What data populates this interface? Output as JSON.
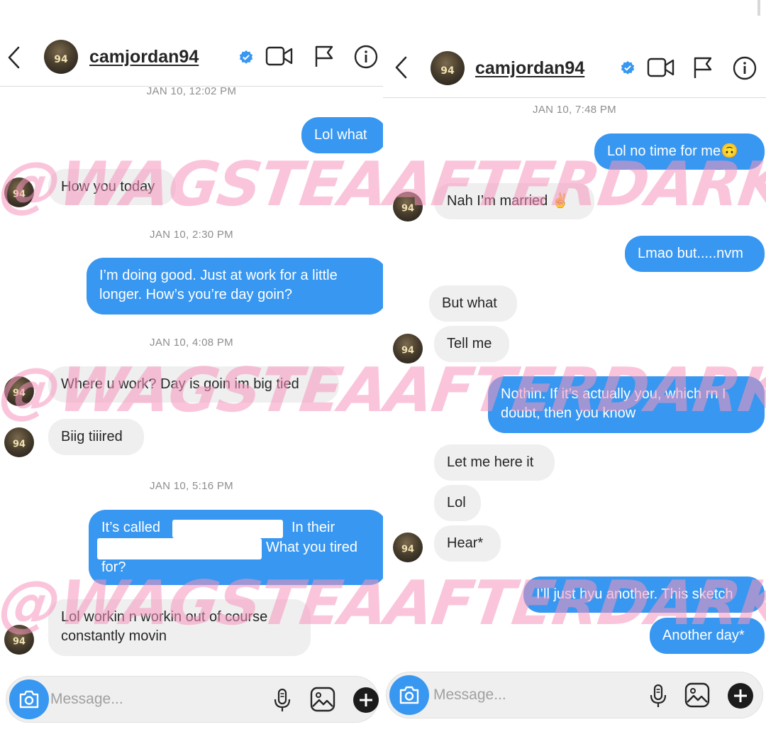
{
  "left": {
    "username": "camjordan94",
    "avatar_number": "94",
    "messages": {
      "ts1": "JAN 10, 12:02 PM",
      "m1": "Lol what",
      "m2": "How you today",
      "ts2": "JAN 10, 2:30 PM",
      "m3a": "I’m doing good. Just at work for a little",
      "m3b": "longer. How’s you’re day goin?",
      "ts3": "JAN 10, 4:08 PM",
      "m4": "Where u work? Day is goin im big tied",
      "m5": "Biig tiiired",
      "ts4": "JAN 10, 5:16 PM",
      "m6a": "It’s called",
      "m6b": "In their",
      "m6c": "What you tired",
      "m6d": "for?",
      "m7a": "Lol workin n workin out of course",
      "m7b": "constantly movin"
    },
    "composer_placeholder": "Message..."
  },
  "right": {
    "username": "camjordan94",
    "avatar_number": "94",
    "messages": {
      "ts1": "JAN 10, 7:48 PM",
      "m1": "Lol no time for me",
      "m1_emoji": "🙃",
      "m2": "Nah I’m married",
      "m2_emoji": "✌",
      "m3": "Lmao but.....nvm",
      "m4": "But what",
      "m5": "Tell me",
      "m6a": "Nothin. If it’s actually you, which rn I",
      "m6b": "doubt, then you know",
      "m7": "Let me here it",
      "m8": "Lol",
      "m9": "Hear*",
      "m10": "I’ll just hyu another. This sketch",
      "m11": "Another day*"
    },
    "composer_placeholder": "Message..."
  },
  "watermark": "@WAGSTEAAFTERDARK",
  "colors": {
    "outgoing_bubble": "#3897f0",
    "incoming_bubble": "#efefef",
    "verified_badge": "#3897f0",
    "watermark": "#f596be"
  },
  "icons": [
    "back-chevron-icon",
    "verified-badge-icon",
    "video-call-icon",
    "flag-icon",
    "info-icon",
    "camera-icon",
    "microphone-icon",
    "gallery-icon",
    "plus-icon"
  ]
}
